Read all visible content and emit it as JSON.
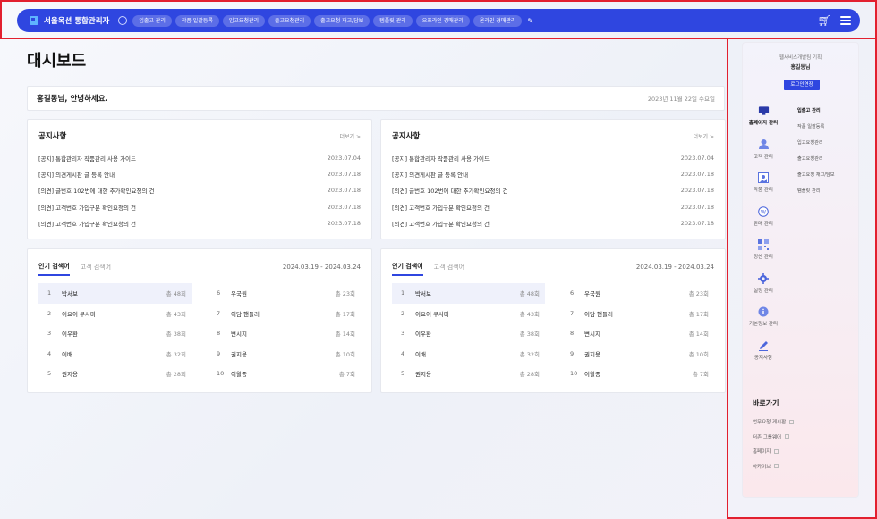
{
  "header": {
    "app_title": "서울옥션 통합관리자",
    "menu": [
      "입출고 관리",
      "작품 일괄등록",
      "입고요청관리",
      "출고요청관리",
      "출고요청 재고/담보",
      "템플릿 관리",
      "오프라인 경매관리",
      "온라인 경매관리"
    ]
  },
  "page_title": "대시보드",
  "greeting": {
    "text": "홍길동님, 안녕하세요.",
    "date": "2023년 11월 22일 수요일"
  },
  "notices": [
    {
      "title": "공지사항",
      "more": "더보기 >",
      "items": [
        {
          "text": "[공지] 통합관리자 작품관리 사용 가이드",
          "date": "2023.07.04"
        },
        {
          "text": "[공지] 의견게시판 글 등록 안내",
          "date": "2023.07.18"
        },
        {
          "text": "[의견] 글번호 102번에 대한 추가확인요청의 건",
          "date": "2023.07.18"
        },
        {
          "text": "[의견] 고객번호 가입구분 확인요청의 건",
          "date": "2023.07.18"
        },
        {
          "text": "[의견] 고객번호 가입구분 확인요청의 건",
          "date": "2023.07.18"
        }
      ]
    },
    {
      "title": "공지사항",
      "more": "더보기 >",
      "items": [
        {
          "text": "[공지] 통합관리자 작품관리 사용 가이드",
          "date": "2023.07.04"
        },
        {
          "text": "[공지] 의견게시판 글 등록 안내",
          "date": "2023.07.18"
        },
        {
          "text": "[의견] 글번호 102번에 대한 추가확인요청의 건",
          "date": "2023.07.18"
        },
        {
          "text": "[의견] 고객번호 가입구분 확인요청의 건",
          "date": "2023.07.18"
        },
        {
          "text": "[의견] 고객번호 가입구분 확인요청의 건",
          "date": "2023.07.18"
        }
      ]
    }
  ],
  "rankings": [
    {
      "tabs": [
        "인기 검색어",
        "고객 검색어"
      ],
      "range": "2024.03.19 - 2024.03.24",
      "left": [
        {
          "n": "1",
          "kw": "박서보",
          "c": "총 48회"
        },
        {
          "n": "2",
          "kw": "이요이 쿠사마",
          "c": "총 43회"
        },
        {
          "n": "3",
          "kw": "이우환",
          "c": "총 38회"
        },
        {
          "n": "4",
          "kw": "이배",
          "c": "총 32회"
        },
        {
          "n": "5",
          "kw": "권지용",
          "c": "총 28회"
        }
      ],
      "right": [
        {
          "n": "6",
          "kw": "우국원",
          "c": "총 23회"
        },
        {
          "n": "7",
          "kw": "이담 핸들러",
          "c": "총 17회"
        },
        {
          "n": "8",
          "kw": "변시지",
          "c": "총 14회"
        },
        {
          "n": "9",
          "kw": "권지용",
          "c": "총 10회"
        },
        {
          "n": "10",
          "kw": "이왈종",
          "c": "총 7회"
        }
      ]
    },
    {
      "tabs": [
        "인기 검색어",
        "고객 검색어"
      ],
      "range": "2024.03.19 - 2024.03.24",
      "left": [
        {
          "n": "1",
          "kw": "박서보",
          "c": "총 48회"
        },
        {
          "n": "2",
          "kw": "이요이 쿠사마",
          "c": "총 43회"
        },
        {
          "n": "3",
          "kw": "이우환",
          "c": "총 38회"
        },
        {
          "n": "4",
          "kw": "이배",
          "c": "총 32회"
        },
        {
          "n": "5",
          "kw": "권지용",
          "c": "총 28회"
        }
      ],
      "right": [
        {
          "n": "6",
          "kw": "우국원",
          "c": "총 23회"
        },
        {
          "n": "7",
          "kw": "이담 핸들러",
          "c": "총 17회"
        },
        {
          "n": "8",
          "kw": "변시지",
          "c": "총 14회"
        },
        {
          "n": "9",
          "kw": "권지용",
          "c": "총 10회"
        },
        {
          "n": "10",
          "kw": "이왈종",
          "c": "총 7회"
        }
      ]
    }
  ],
  "side": {
    "dept": "웹서비스개발팀 기획",
    "user": "홍길동님",
    "extend_label": "로그인연장",
    "menu": [
      {
        "label": "홈페이지 관리",
        "icon": "monitor-icon"
      },
      {
        "label": "고객 관리",
        "icon": "user-icon"
      },
      {
        "label": "작품 관리",
        "icon": "image-icon"
      },
      {
        "label": "판매 관리",
        "icon": "won-icon"
      },
      {
        "label": "정산 관리",
        "icon": "qr-icon"
      },
      {
        "label": "설정 관리",
        "icon": "gear-icon"
      },
      {
        "label": "기본정보 관리",
        "icon": "info-icon"
      },
      {
        "label": "공지사항",
        "icon": "pencil-icon"
      }
    ],
    "submenu": [
      "입출고 관리",
      "작품 일괄등록",
      "입고요청관리",
      "출고요청관리",
      "출고요청 재고/담보",
      "템플릿 관리"
    ],
    "quick_title": "바로가기",
    "quick": [
      "업무요청 게시판",
      "더존 그룹웨어",
      "홈페이지",
      "아카이브"
    ]
  },
  "colors": {
    "primary": "#2f46e0",
    "highlight": "#e2202f"
  }
}
